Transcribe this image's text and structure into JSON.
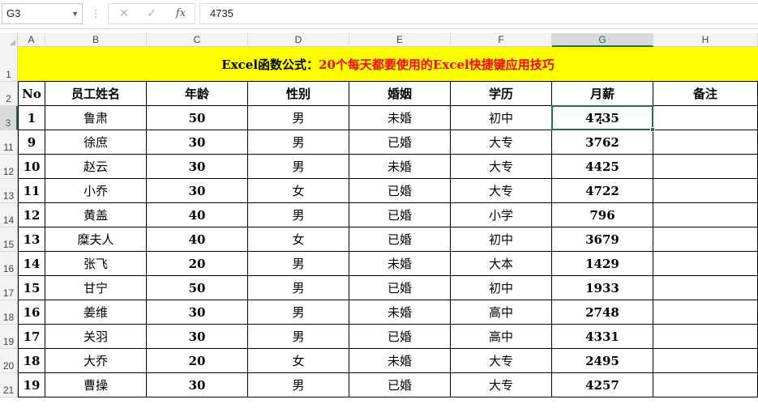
{
  "formula_bar": {
    "name_box": "G3",
    "cancel_glyph": "✕",
    "enter_glyph": "✓",
    "fx_label": "fx",
    "value": "4735"
  },
  "columns": [
    "A",
    "B",
    "C",
    "D",
    "E",
    "F",
    "G",
    "H"
  ],
  "selected_column": "G",
  "selected_row": "3",
  "row_numbers": [
    "1",
    "2",
    "3",
    "11",
    "12",
    "13",
    "14",
    "15",
    "16",
    "17",
    "18",
    "19",
    "20",
    "21"
  ],
  "title": {
    "part1": "Excel函数公式：",
    "part2": "20个每天都要使用的Excel快捷键应用技巧"
  },
  "headers": [
    "No",
    "员工姓名",
    "年龄",
    "性别",
    "婚姻",
    "学历",
    "月薪",
    "备注"
  ],
  "rows": [
    [
      "1",
      "鲁肃",
      "50",
      "男",
      "未婚",
      "初中",
      "4735",
      ""
    ],
    [
      "9",
      "徐庶",
      "30",
      "男",
      "已婚",
      "大专",
      "3762",
      ""
    ],
    [
      "10",
      "赵云",
      "30",
      "男",
      "未婚",
      "大专",
      "4425",
      ""
    ],
    [
      "11",
      "小乔",
      "30",
      "女",
      "已婚",
      "大专",
      "4722",
      ""
    ],
    [
      "12",
      "黄盖",
      "40",
      "男",
      "已婚",
      "小学",
      "796",
      ""
    ],
    [
      "13",
      "糜夫人",
      "40",
      "女",
      "已婚",
      "初中",
      "3679",
      ""
    ],
    [
      "14",
      "张飞",
      "20",
      "男",
      "未婚",
      "大本",
      "1429",
      ""
    ],
    [
      "15",
      "甘宁",
      "50",
      "男",
      "已婚",
      "初中",
      "1933",
      ""
    ],
    [
      "16",
      "姜维",
      "30",
      "男",
      "未婚",
      "高中",
      "2748",
      ""
    ],
    [
      "17",
      "关羽",
      "30",
      "男",
      "已婚",
      "高中",
      "4331",
      ""
    ],
    [
      "18",
      "大乔",
      "20",
      "女",
      "未婚",
      "大专",
      "2495",
      ""
    ],
    [
      "19",
      "曹操",
      "30",
      "男",
      "已婚",
      "大专",
      "4257",
      ""
    ]
  ],
  "colors": {
    "title_fill": "#ffff00",
    "title_accent": "#ff0000",
    "selection": "#217346"
  }
}
